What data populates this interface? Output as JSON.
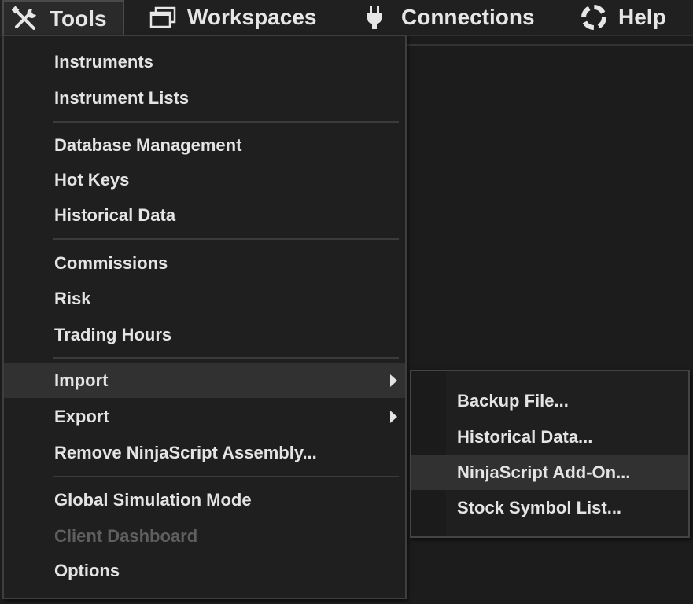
{
  "menubar": {
    "items": [
      {
        "label": "Tools",
        "icon": "tools-icon"
      },
      {
        "label": "Workspaces",
        "icon": "workspaces-icon"
      },
      {
        "label": "Connections",
        "icon": "plug-icon"
      },
      {
        "label": "Help",
        "icon": "help-lifebuoy-icon"
      }
    ]
  },
  "tools_menu": {
    "items": [
      {
        "label": "Instruments"
      },
      {
        "label": "Instrument Lists"
      },
      {
        "label": "Database Management"
      },
      {
        "label": "Hot Keys"
      },
      {
        "label": "Historical Data"
      },
      {
        "label": "Commissions"
      },
      {
        "label": "Risk"
      },
      {
        "label": "Trading Hours"
      },
      {
        "label": "Import",
        "submenu": true,
        "highlighted": true
      },
      {
        "label": "Export",
        "submenu": true
      },
      {
        "label": "Remove NinjaScript Assembly..."
      },
      {
        "label": "Global Simulation Mode"
      },
      {
        "label": "Client Dashboard",
        "disabled": true
      },
      {
        "label": "Options"
      }
    ]
  },
  "import_submenu": {
    "items": [
      {
        "label": "Backup File..."
      },
      {
        "label": "Historical Data..."
      },
      {
        "label": "NinjaScript Add-On...",
        "highlighted": true
      },
      {
        "label": "Stock Symbol List..."
      }
    ]
  },
  "colors": {
    "background": "#1c1c1c",
    "menu_bg": "#1f1f1f",
    "highlight": "#313131",
    "text": "#e4e4e4",
    "disabled_text": "#5f5f5f"
  }
}
